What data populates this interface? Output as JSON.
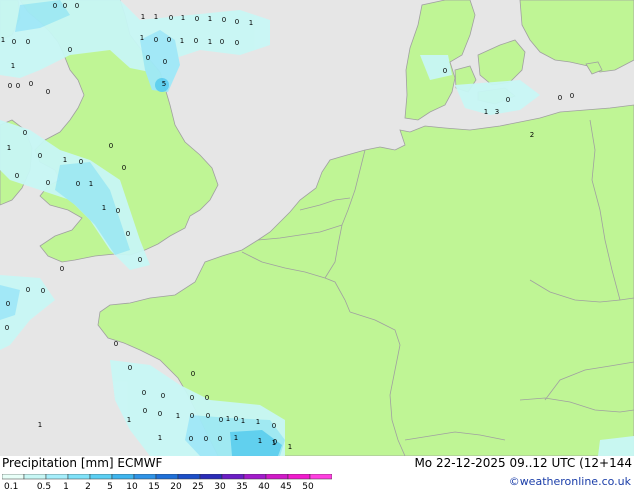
{
  "header": {
    "title": "Precipitation [mm] ECMWF",
    "valid_time": "Mo 22-12-2025 09..12 UTC (12+144",
    "credit": "©weatheronline.co.uk"
  },
  "legend": {
    "labels": [
      "0.1",
      "0.5",
      "1",
      "2",
      "5",
      "10",
      "15",
      "20",
      "25",
      "30",
      "35",
      "40",
      "45",
      "50"
    ],
    "colors": [
      "#e8fff8",
      "#c8f7f5",
      "#a6eefb",
      "#80e2f9",
      "#5ccff3",
      "#3fb5ee",
      "#2f93e6",
      "#1f70d8",
      "#1c4fc8",
      "#2a2cb8",
      "#6b1dc5",
      "#a21bcb",
      "#d01ac8",
      "#f01bcd",
      "#ff40e0"
    ]
  },
  "map": {
    "land_color": "#bff595",
    "sea_color": "#e6e6e6",
    "border_color": "#a0a0a0",
    "rain_light": "#c8f7f5",
    "rain_mid": "#9fe9f8",
    "rain_heavy": "#5ccff3",
    "cell_values": [
      {
        "v": "0"
      },
      {
        "v": "0"
      },
      {
        "v": "0"
      },
      {
        "v": "1"
      },
      {
        "v": "1"
      },
      {
        "v": "0"
      },
      {
        "v": "1"
      },
      {
        "v": "0"
      },
      {
        "v": "1"
      },
      {
        "v": "0"
      },
      {
        "v": "0"
      },
      {
        "v": "1"
      },
      {
        "v": "1"
      },
      {
        "v": "0"
      },
      {
        "v": "0"
      },
      {
        "v": "1"
      },
      {
        "v": "0"
      },
      {
        "v": "0"
      },
      {
        "v": "1"
      },
      {
        "v": "0"
      },
      {
        "v": "1"
      },
      {
        "v": "0"
      },
      {
        "v": "0"
      },
      {
        "v": "5"
      },
      {
        "v": "0"
      },
      {
        "v": "1"
      },
      {
        "v": "0"
      },
      {
        "v": "0"
      },
      {
        "v": "0"
      },
      {
        "v": "0"
      },
      {
        "v": "0"
      },
      {
        "v": "0"
      },
      {
        "v": "0"
      },
      {
        "v": "1"
      },
      {
        "v": "0"
      },
      {
        "v": "1"
      },
      {
        "v": "0"
      },
      {
        "v": "0"
      },
      {
        "v": "0"
      },
      {
        "v": "0"
      },
      {
        "v": "0"
      },
      {
        "v": "1"
      },
      {
        "v": "0"
      },
      {
        "v": "1"
      },
      {
        "v": "0"
      },
      {
        "v": "0"
      },
      {
        "v": "0"
      },
      {
        "v": "0"
      },
      {
        "v": "0"
      },
      {
        "v": "0"
      },
      {
        "v": "0"
      },
      {
        "v": "0"
      },
      {
        "v": "0"
      },
      {
        "v": "0"
      },
      {
        "v": "0"
      },
      {
        "v": "0"
      },
      {
        "v": "0"
      },
      {
        "v": "1"
      },
      {
        "v": "0"
      },
      {
        "v": "0"
      },
      {
        "v": "1"
      },
      {
        "v": "0"
      },
      {
        "v": "0"
      },
      {
        "v": "1"
      },
      {
        "v": "0"
      },
      {
        "v": "0"
      },
      {
        "v": "0"
      },
      {
        "v": "1"
      },
      {
        "v": "1"
      },
      {
        "v": "0"
      },
      {
        "v": "0"
      },
      {
        "v": "0"
      },
      {
        "v": "1"
      },
      {
        "v": "1"
      },
      {
        "v": "1"
      },
      {
        "v": "1"
      },
      {
        "v": "0"
      },
      {
        "v": "0"
      },
      {
        "v": "0"
      },
      {
        "v": "1"
      },
      {
        "v": "1"
      },
      {
        "v": "1"
      },
      {
        "v": "3"
      },
      {
        "v": "2"
      },
      {
        "v": "0"
      },
      {
        "v": "0"
      },
      {
        "v": "0"
      },
      {
        "v": "0"
      }
    ]
  }
}
